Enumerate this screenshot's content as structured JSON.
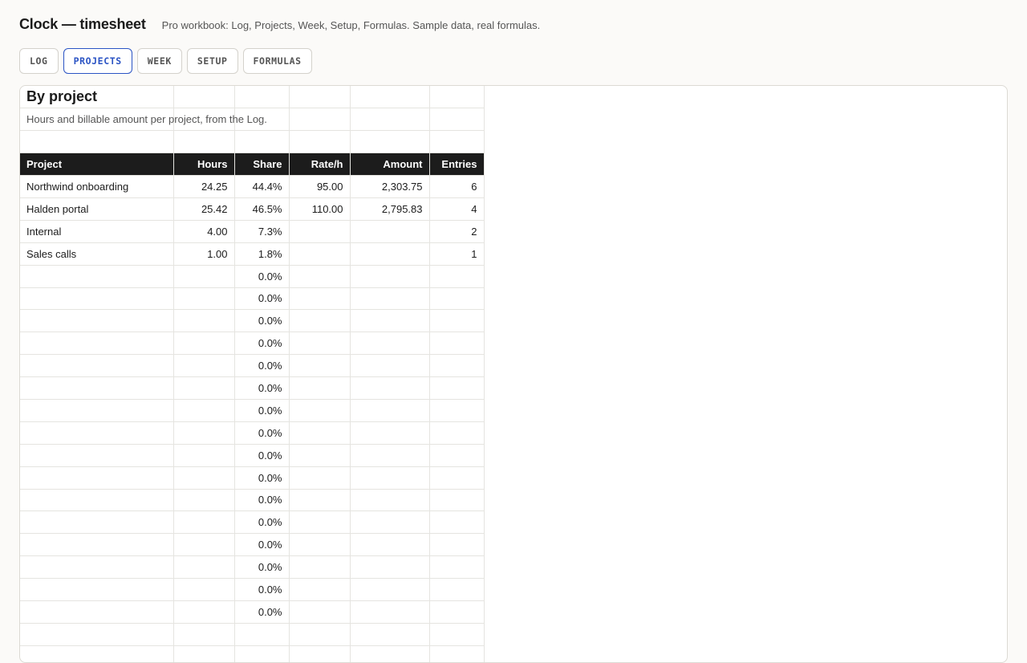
{
  "app": {
    "title": "Clock — timesheet",
    "subtitle": "Pro workbook: Log, Projects, Week, Setup, Formulas. Sample data, real formulas."
  },
  "tabs": [
    {
      "label": "LOG",
      "active": false
    },
    {
      "label": "PROJECTS",
      "active": true
    },
    {
      "label": "WEEK",
      "active": false
    },
    {
      "label": "SETUP",
      "active": false
    },
    {
      "label": "FORMULAS",
      "active": false
    }
  ],
  "sheet": {
    "title": "By project",
    "description": "Hours and billable amount per project, from the Log.",
    "columns": [
      "Project",
      "Hours",
      "Share",
      "Rate/h",
      "Amount",
      "Entries"
    ],
    "rows": [
      [
        "Northwind onboarding",
        "24.25",
        "44.4%",
        "95.00",
        "2,303.75",
        "6"
      ],
      [
        "Halden portal",
        "25.42",
        "46.5%",
        "110.00",
        "2,795.83",
        "4"
      ],
      [
        "Internal",
        "4.00",
        "7.3%",
        "",
        "",
        "2"
      ],
      [
        "Sales calls",
        "1.00",
        "1.8%",
        "",
        "",
        "1"
      ],
      [
        "",
        "",
        "0.0%",
        "",
        "",
        ""
      ],
      [
        "",
        "",
        "0.0%",
        "",
        "",
        ""
      ],
      [
        "",
        "",
        "0.0%",
        "",
        "",
        ""
      ],
      [
        "",
        "",
        "0.0%",
        "",
        "",
        ""
      ],
      [
        "",
        "",
        "0.0%",
        "",
        "",
        ""
      ],
      [
        "",
        "",
        "0.0%",
        "",
        "",
        ""
      ],
      [
        "",
        "",
        "0.0%",
        "",
        "",
        ""
      ],
      [
        "",
        "",
        "0.0%",
        "",
        "",
        ""
      ],
      [
        "",
        "",
        "0.0%",
        "",
        "",
        ""
      ],
      [
        "",
        "",
        "0.0%",
        "",
        "",
        ""
      ],
      [
        "",
        "",
        "0.0%",
        "",
        "",
        ""
      ],
      [
        "",
        "",
        "0.0%",
        "",
        "",
        ""
      ],
      [
        "",
        "",
        "0.0%",
        "",
        "",
        ""
      ],
      [
        "",
        "",
        "0.0%",
        "",
        "",
        ""
      ],
      [
        "",
        "",
        "0.0%",
        "",
        "",
        ""
      ],
      [
        "",
        "",
        "0.0%",
        "",
        "",
        ""
      ],
      [
        "",
        "",
        "",
        "",
        "",
        ""
      ],
      [
        "",
        "",
        "",
        "",
        "",
        ""
      ]
    ]
  },
  "colors": {
    "accent": "#2b54c4",
    "header_bg": "#1c1c1c",
    "page_bg": "#fbfaf8"
  }
}
